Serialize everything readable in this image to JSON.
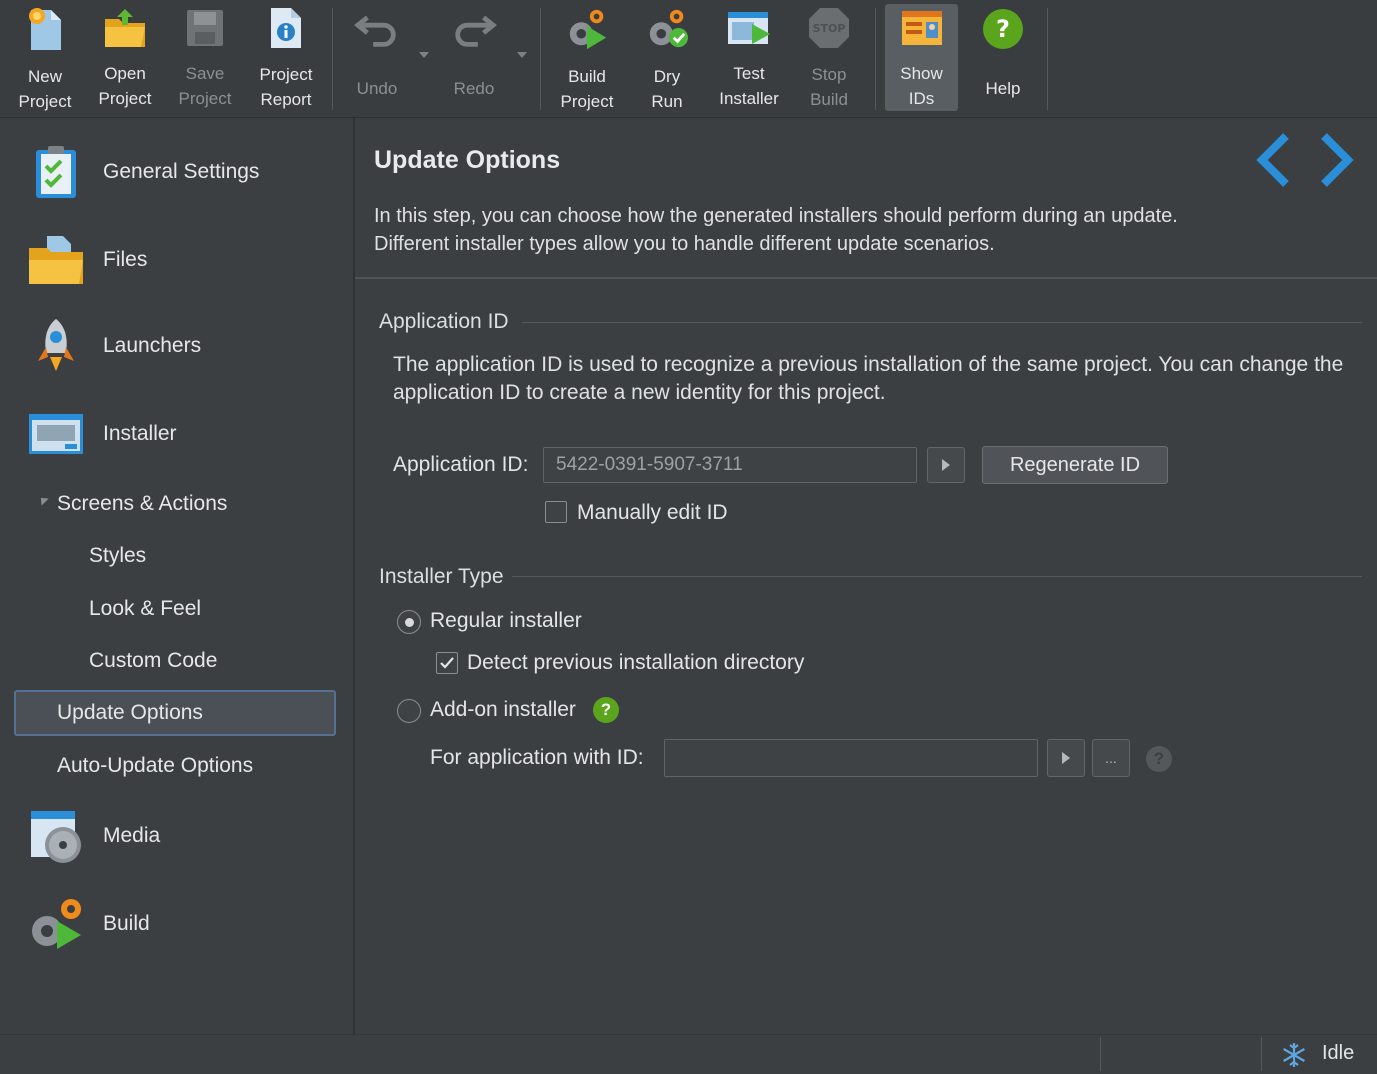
{
  "toolbar": {
    "new_project": "New\nProject",
    "open_project": "Open\nProject",
    "save_project": "Save\nProject",
    "project_report": "Project\nReport",
    "undo": "Undo",
    "redo": "Redo",
    "build_project": "Build\nProject",
    "dry_run": "Dry\nRun",
    "test_installer": "Test\nInstaller",
    "stop_build": "Stop\nBuild",
    "show_ids": "Show\nIDs",
    "help": "Help",
    "stop_sign_text": "STOP"
  },
  "sidebar": {
    "general_settings": "General Settings",
    "files": "Files",
    "launchers": "Launchers",
    "installer": "Installer",
    "screens_actions": "Screens & Actions",
    "styles": "Styles",
    "look_feel": "Look & Feel",
    "custom_code": "Custom Code",
    "update_options": "Update Options",
    "auto_update_options": "Auto-Update Options",
    "media": "Media",
    "build": "Build"
  },
  "main": {
    "title": "Update Options",
    "description_line1": "In this step, you can choose how the generated installers should perform during an update.",
    "description_line2": "Different installer types allow you to handle different update scenarios.",
    "app_id_group": {
      "title": "Application ID",
      "para_line1": "The application ID is used to recognize a previous installation of the same project. You can change the",
      "para_line2": "application ID to create a new identity for this project.",
      "label": "Application ID:",
      "value": "5422-0391-5907-3711",
      "regenerate": "Regenerate ID",
      "manual_edit": "Manually edit ID"
    },
    "installer_type_group": {
      "title": "Installer Type",
      "regular": "Regular installer",
      "detect_prev": "Detect previous installation directory",
      "addon": "Add-on installer",
      "for_app_label": "For application with ID:",
      "for_app_value": "",
      "ellipsis": "...",
      "help_mark": "?"
    }
  },
  "status": {
    "text": "Idle"
  },
  "colors": {
    "accent_blue": "#2a8fd8",
    "help_green": "#5aa51c",
    "selection_border": "#55718f"
  }
}
